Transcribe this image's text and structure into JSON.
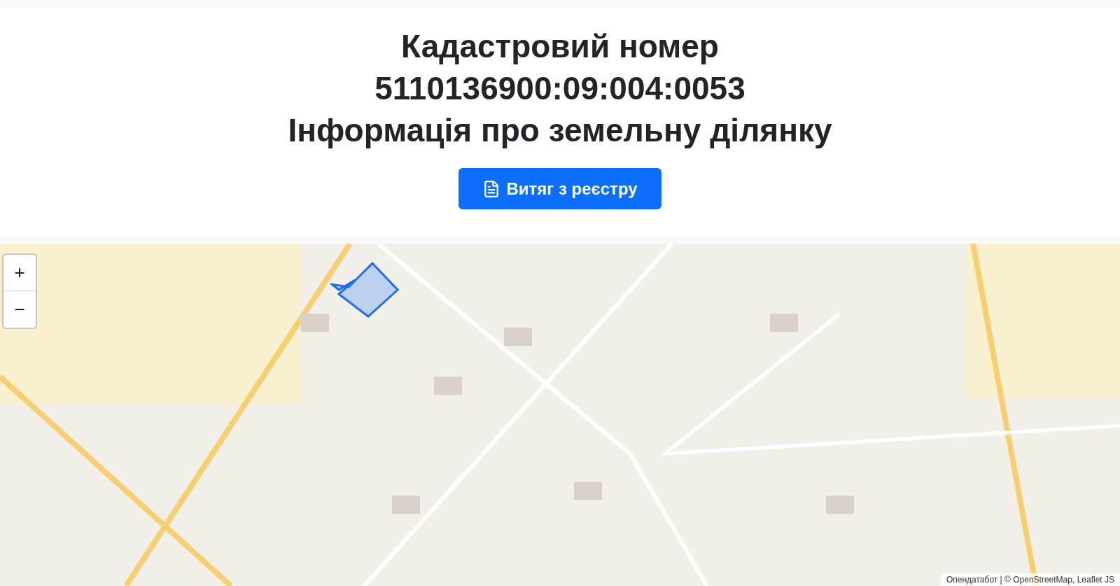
{
  "header": {
    "title_lines": [
      "Кадастровий номер",
      "5110136900:09:004:0053",
      "Інформація про земельну ділянку"
    ],
    "button": {
      "label": "Витяг з реєстру"
    }
  },
  "map": {
    "zoom_in": "+",
    "zoom_out": "−",
    "attribution": "Опендатабот | © OpenStreetMap, Leaflet JS"
  }
}
